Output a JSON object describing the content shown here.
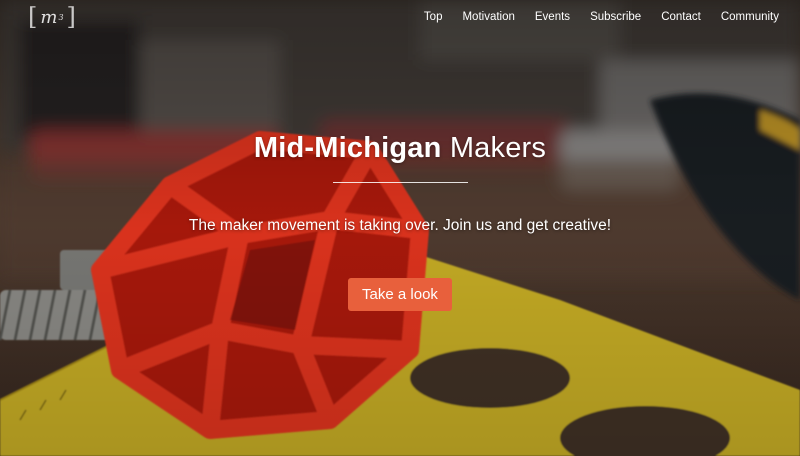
{
  "logo": {
    "text": "m",
    "superscript": "3",
    "bracket_left": "[",
    "bracket_right": "]"
  },
  "nav": {
    "items": [
      {
        "label": "Top"
      },
      {
        "label": "Motivation"
      },
      {
        "label": "Events"
      },
      {
        "label": "Subscribe"
      },
      {
        "label": "Contact"
      },
      {
        "label": "Community"
      }
    ]
  },
  "hero": {
    "title_strong": "Mid-Michigan",
    "title_light": "Makers",
    "tagline": "The maker movement is taking over. Join us and get creative!",
    "cta_label": "Take a look"
  },
  "colors": {
    "accent": "#e8603c",
    "background_dark": "#2a221c",
    "text": "#ffffff"
  }
}
